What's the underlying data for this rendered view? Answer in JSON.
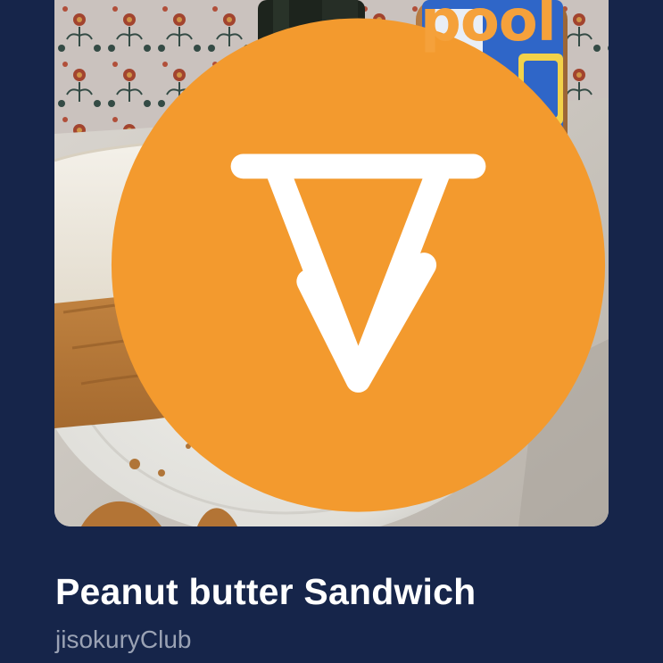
{
  "post": {
    "title": "Peanut butter Sandwich",
    "author": "jisokuryClub"
  },
  "photo": {
    "overlay_text": "pool",
    "logo_icon": "app-logo-icon"
  },
  "colors": {
    "background": "#16254a",
    "title": "#ffffff",
    "subtitle": "#9aa2b4",
    "logo": "#f39a2e",
    "jar_text": "#f5a13b"
  }
}
